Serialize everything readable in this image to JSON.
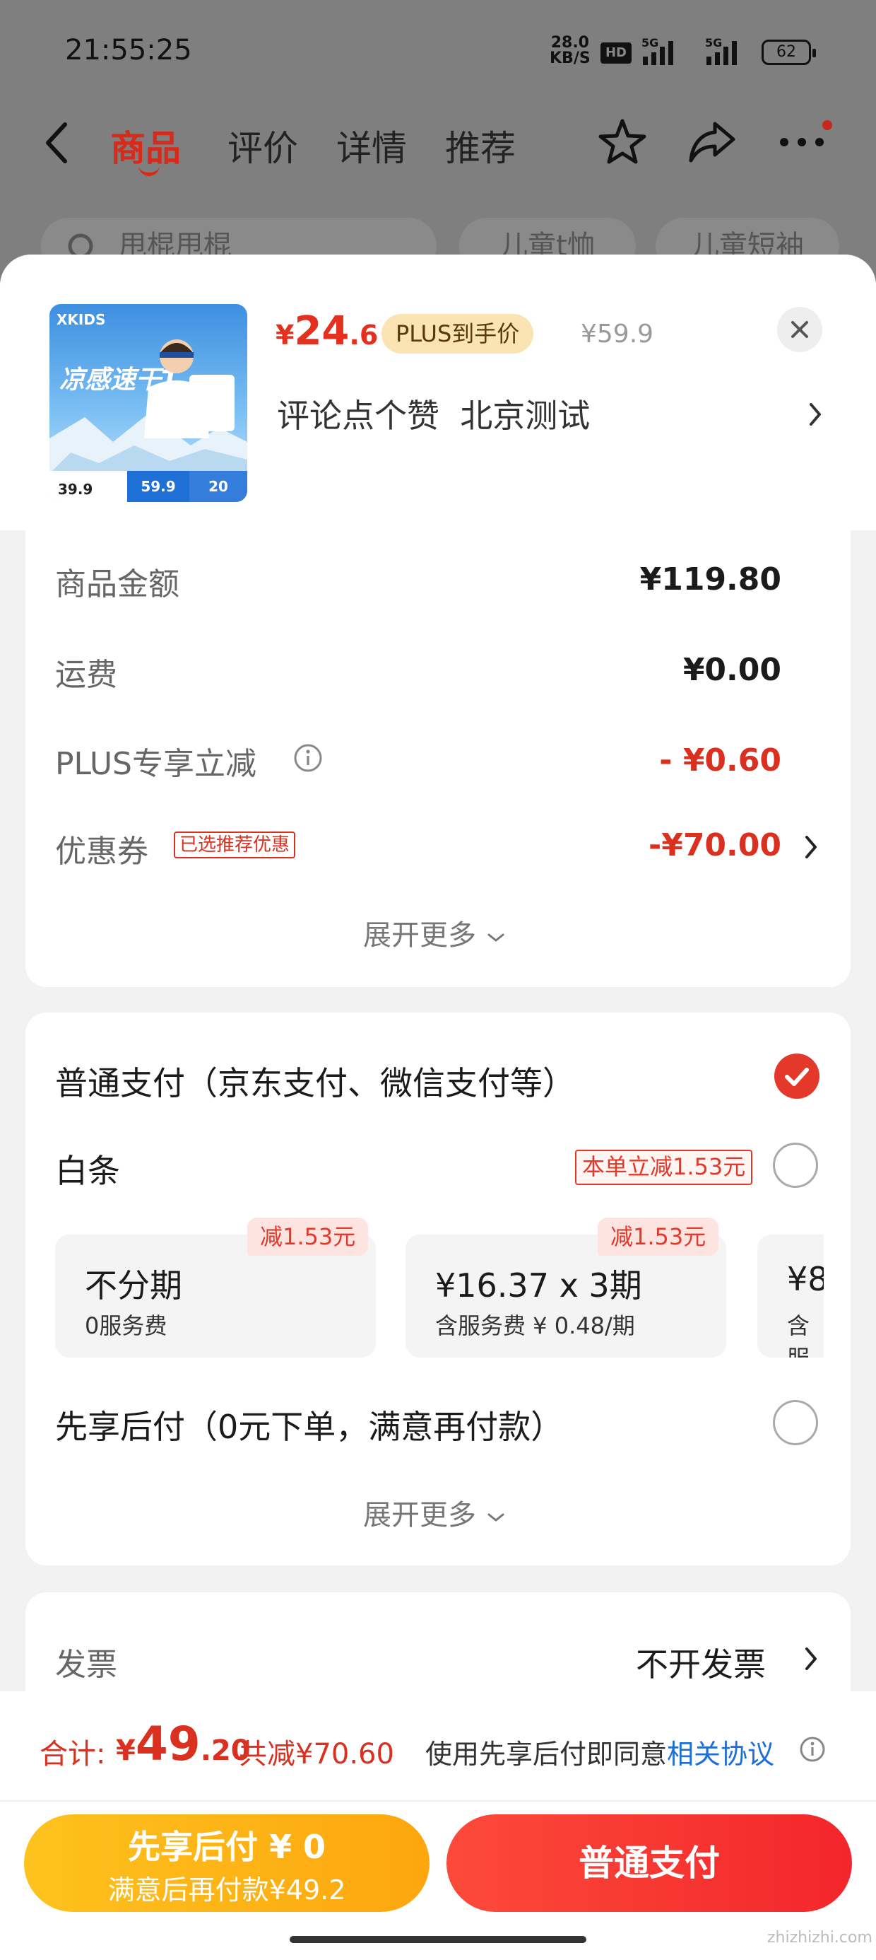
{
  "status_bar": {
    "time": "21:55:25",
    "net_speed_value": "28.0",
    "net_speed_unit": "KB/S",
    "hd_label": "HD",
    "signal_label": "5G",
    "battery": "62"
  },
  "header": {
    "tabs": [
      {
        "label": "商品",
        "active": true
      },
      {
        "label": "评价",
        "active": false
      },
      {
        "label": "详情",
        "active": false
      },
      {
        "label": "推荐",
        "active": false
      }
    ],
    "search_placeholder": "甩棍甩棍",
    "chips": [
      "儿童t恤",
      "儿童短袖"
    ]
  },
  "product": {
    "image_brand": "XKIDS",
    "image_headline": "凉感速干T",
    "image_prices": [
      "39.9",
      "59.9",
      "20"
    ],
    "price_symbol": "¥",
    "price_int": "24",
    "price_dec": ".6",
    "plus_badge": "PLUS到手价",
    "original_price": "¥59.9",
    "title": "评论点个赞  北京测试"
  },
  "summary": {
    "rows": [
      {
        "label": "商品金额",
        "value": "¥119.80"
      },
      {
        "label": "运费",
        "value": "¥0.00"
      },
      {
        "label": "PLUS专享立减",
        "value": "- ¥0.60"
      },
      {
        "label": "优惠券",
        "value": "-¥70.00",
        "tag": "已选推荐优惠"
      }
    ],
    "expand_label": "展开更多"
  },
  "payment": {
    "options": [
      {
        "label": "普通支付（京东支付、微信支付等）",
        "selected": true
      },
      {
        "label": "白条",
        "selected": false,
        "promo": "本单立减1.53元"
      },
      {
        "label": "先享后付（0元下单，满意再付款）",
        "selected": false
      }
    ],
    "plans": [
      {
        "main": "不分期",
        "sub": "0服务费",
        "tag": "减1.53元"
      },
      {
        "main": "¥16.37 x 3期",
        "sub": "含服务费 ¥ 0.48/期",
        "tag": "减1.53元"
      },
      {
        "main": "¥8",
        "sub": "含服"
      }
    ],
    "expand_label": "展开更多"
  },
  "invoice": {
    "label": "发票",
    "value": "不开发票"
  },
  "footer": {
    "total_label": "合计:",
    "total_symbol": "¥",
    "total_int": "49",
    "total_dec": ".20",
    "saving": "共减¥70.60",
    "agree_text": "使用先享后付即同意",
    "agree_link": "相关协议",
    "later_line1": "先享后付 ¥ 0",
    "later_line2": "满意后再付款¥49.2",
    "pay_button": "普通支付"
  },
  "watermark": "zhizhizhi.com",
  "colors": {
    "accent_red": "#e4311f",
    "plus_gold": "#fbe4b4",
    "link_blue": "#1e6ed8",
    "later_button": "#fdb418"
  }
}
